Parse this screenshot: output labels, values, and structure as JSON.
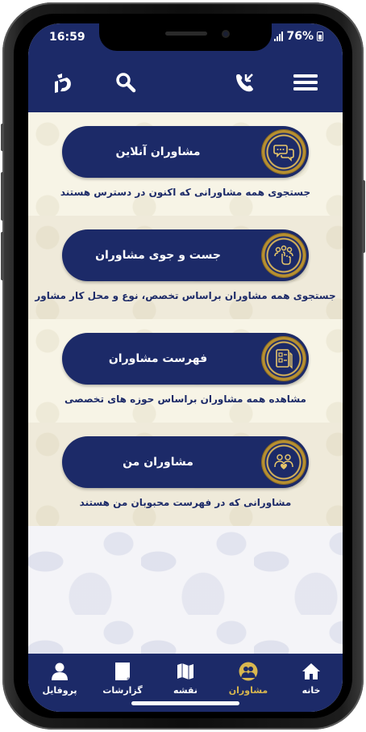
{
  "status_bar": {
    "time": "16:59",
    "battery": "76%"
  },
  "header": {
    "menu_icon": "hamburger-menu-icon",
    "call_icon": "phone-call-icon",
    "search_icon": "search-icon",
    "logo_icon": "app-logo-icon"
  },
  "menu": [
    {
      "label": "مشاوران آنلاین",
      "description": "جستجوی همه مشاورانی که اکنون در دسترس هستند",
      "icon": "chat-bubbles-icon"
    },
    {
      "label": "جست و جوی مشاوران",
      "description": "جستجوی همه مشاوران براساس تخصص، نوع و محل کار مشاور",
      "icon": "consultant-search-icon"
    },
    {
      "label": "فهرست مشاوران",
      "description": "مشاهده همه مشاوران براساس حوزه های تخصصی",
      "icon": "document-list-icon"
    },
    {
      "label": "مشاوران من",
      "description": "مشاورانی که در فهرست محبوبان من هستند",
      "icon": "my-consultants-icon"
    }
  ],
  "bottom_nav": [
    {
      "label": "خانه",
      "icon": "home-icon",
      "active": false
    },
    {
      "label": "مشاوران",
      "icon": "consultants-icon",
      "active": true
    },
    {
      "label": "نقشه",
      "icon": "map-icon",
      "active": false
    },
    {
      "label": "گزارشات",
      "icon": "reports-icon",
      "active": false
    },
    {
      "label": "پروفایل",
      "icon": "profile-icon",
      "active": false
    }
  ],
  "colors": {
    "primary": "#1c2a68",
    "accent_gold": "#d9b74f",
    "background": "#f7f4e6"
  }
}
